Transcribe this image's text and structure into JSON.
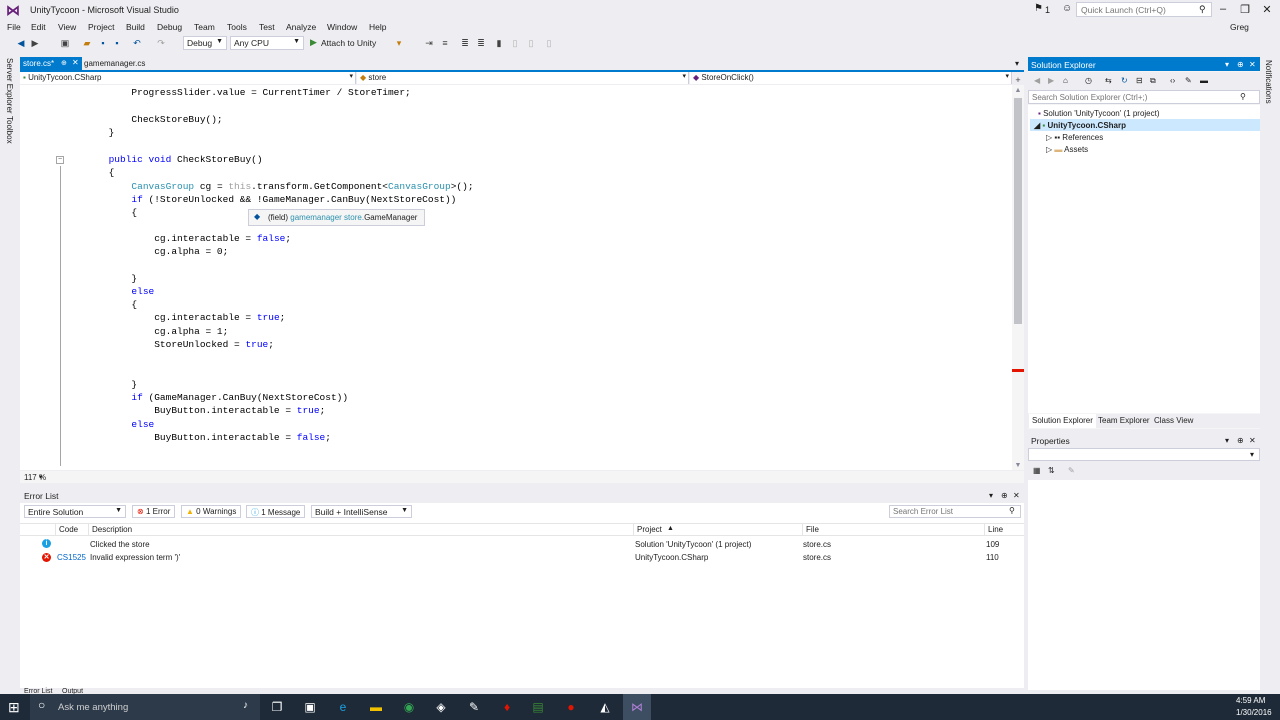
{
  "window": {
    "title": "UnityTycoon - Microsoft Visual Studio",
    "notification_count": "1",
    "quick_launch_placeholder": "Quick Launch (Ctrl+Q)",
    "user": "Greg"
  },
  "menu": [
    "File",
    "Edit",
    "View",
    "Project",
    "Build",
    "Debug",
    "Team",
    "Tools",
    "Test",
    "Analyze",
    "Window",
    "Help"
  ],
  "toolbar": {
    "configuration": "Debug",
    "platform": "Any CPU",
    "attach_label": "Attach to Unity"
  },
  "left_strip": [
    "Server Explorer",
    "Toolbox"
  ],
  "tabs": [
    {
      "label": "store.cs*",
      "active": true
    },
    {
      "label": "gamemanager.cs",
      "active": false
    }
  ],
  "navbar": {
    "project": "UnityTycoon.CSharp",
    "type": "store",
    "member": "StoreOnClick()"
  },
  "code_lines": [
    "            ProgressSlider.value = CurrentTimer / StoreTimer;",
    "",
    "            CheckStoreBuy();",
    "        }",
    "",
    "        public void CheckStoreBuy()",
    "        {",
    "            CanvasGroup cg = this.transform.GetComponent<CanvasGroup>();",
    "            if (!StoreUnlocked && !GameManager.CanBuy(NextStoreCost))",
    "            {",
    "",
    "                cg.interactable = false;",
    "                cg.alpha = 0;",
    "",
    "            }",
    "            else",
    "            {",
    "                cg.interactable = true;",
    "                cg.alpha = 1;",
    "                StoreUnlocked = true;",
    "",
    "",
    "            }",
    "            if (GameManager.CanBuy(NextStoreCost))",
    "                BuyButton.interactable = true;",
    "            else",
    "                BuyButton.interactable = false;"
  ],
  "tooltip": {
    "kind": "(field)",
    "path": "gamemanager store.",
    "name": "GameManager"
  },
  "editor": {
    "zoom": "117 %"
  },
  "error_list": {
    "title": "Error List",
    "scope": "Entire Solution",
    "errors_btn": "1 Error",
    "warnings_btn": "0 Warnings",
    "messages_btn": "1 Message",
    "build_filter": "Build + IntelliSense",
    "search_placeholder": "Search Error List",
    "columns": {
      "code": "Code",
      "description": "Description",
      "project": "Project",
      "file": "File",
      "line": "Line"
    },
    "rows": [
      {
        "type": "info",
        "code": "",
        "description": "Clicked the store",
        "project": "Solution 'UnityTycoon' (1 project)",
        "file": "store.cs",
        "line": "109"
      },
      {
        "type": "error",
        "code": "CS1525",
        "description": "Invalid expression term ')'",
        "project": "UnityTycoon.CSharp",
        "file": "store.cs",
        "line": "110"
      }
    ],
    "bottom_tabs": [
      "Error List",
      "Output"
    ]
  },
  "solution_explorer": {
    "title": "Solution Explorer",
    "search_placeholder": "Search Solution Explorer (Ctrl+;)",
    "tree": [
      {
        "label": "Solution 'UnityTycoon' (1 project)",
        "level": 0
      },
      {
        "label": "UnityTycoon.CSharp",
        "level": 1,
        "selected": true
      },
      {
        "label": "References",
        "level": 2
      },
      {
        "label": "Assets",
        "level": 2
      }
    ],
    "tabs": [
      "Solution Explorer",
      "Team Explorer",
      "Class View"
    ]
  },
  "properties": {
    "title": "Properties"
  },
  "right_strip": "Notifications",
  "taskbar": {
    "search_placeholder": "Ask me anything",
    "time": "4:59 AM",
    "date": "1/30/2016"
  },
  "colors": {
    "accent": "#007acc",
    "error": "#e51400",
    "info": "#1ba1e2",
    "vs_purple": "#68217a"
  }
}
